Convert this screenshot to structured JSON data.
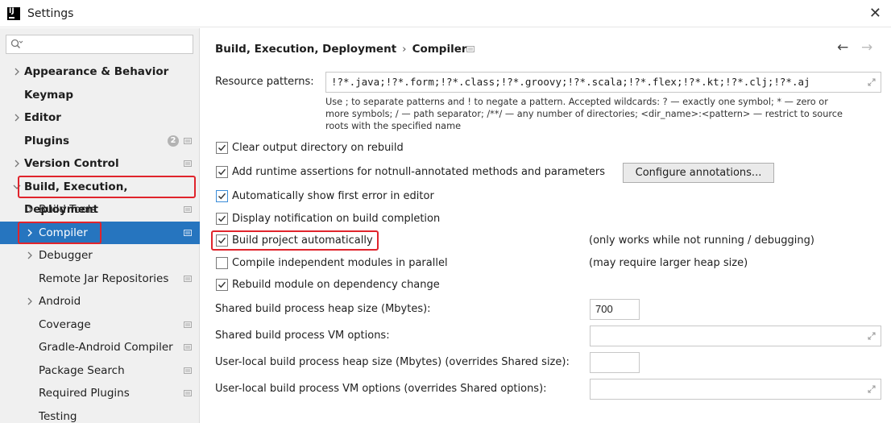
{
  "window": {
    "title": "Settings",
    "logo_text": "IJ",
    "close_symbol": "✕"
  },
  "sidebar": {
    "search_placeholder": "",
    "items": [
      {
        "label": "Appearance & Behavior",
        "expandable": true,
        "bold": true
      },
      {
        "label": "Keymap",
        "expandable": false,
        "bold": true
      },
      {
        "label": "Editor",
        "expandable": true,
        "bold": true
      },
      {
        "label": "Plugins",
        "expandable": false,
        "bold": true,
        "badge": "2"
      },
      {
        "label": "Version Control",
        "expandable": true,
        "bold": true
      },
      {
        "label": "Build, Execution, Deployment",
        "expandable": true,
        "expanded": true,
        "bold": true,
        "highlighted": true
      },
      {
        "label": "Build Tools",
        "expandable": true,
        "bold": false
      },
      {
        "label": "Compiler",
        "expandable": true,
        "bold": false,
        "selected": true,
        "highlighted": true
      },
      {
        "label": "Debugger",
        "expandable": true,
        "bold": false
      },
      {
        "label": "Remote Jar Repositories",
        "expandable": false,
        "bold": false
      },
      {
        "label": "Android",
        "expandable": true,
        "bold": false
      },
      {
        "label": "Coverage",
        "expandable": false,
        "bold": false
      },
      {
        "label": "Gradle-Android Compiler",
        "expandable": false,
        "bold": false
      },
      {
        "label": "Package Search",
        "expandable": false,
        "bold": false
      },
      {
        "label": "Required Plugins",
        "expandable": false,
        "bold": false
      },
      {
        "label": "Testing",
        "expandable": false,
        "bold": false
      }
    ]
  },
  "main": {
    "breadcrumb": {
      "parent": "Build, Execution, Deployment",
      "separator": "›",
      "current": "Compiler"
    },
    "nav": {
      "back": "←",
      "forward": "→"
    },
    "resource_patterns": {
      "label": "Resource patterns:",
      "value": "!?*.java;!?*.form;!?*.class;!?*.groovy;!?*.scala;!?*.flex;!?*.kt;!?*.clj;!?*.aj"
    },
    "hint_lines": [
      "Use ; to separate patterns and ! to negate a pattern. Accepted wildcards: ? — exactly one symbol; * — zero or",
      "more symbols; / — path separator; /**/ — any number of directories; <dir_name>:<pattern> — restrict to source",
      "roots with the specified name"
    ],
    "options": {
      "clear_output": {
        "label": "Clear output directory on rebuild",
        "checked": true
      },
      "runtime_assertions": {
        "label": "Add runtime assertions for notnull-annotated methods and parameters",
        "checked": true
      },
      "configure_annotations": "Configure annotations...",
      "show_first_error": {
        "label": "Automatically show first error in editor",
        "checked": true
      },
      "display_notification": {
        "label": "Display notification on build completion",
        "checked": true
      },
      "build_automatically": {
        "label": "Build project automatically",
        "checked": true,
        "note": "(only works while not running / debugging)"
      },
      "compile_parallel": {
        "label": "Compile independent modules in parallel",
        "checked": false,
        "note": "(may require larger heap size)"
      },
      "rebuild_on_dependency": {
        "label": "Rebuild module on dependency change",
        "checked": true
      }
    },
    "fields": {
      "shared_heap": {
        "label": "Shared build process heap size (Mbytes):",
        "value": "700"
      },
      "shared_vm": {
        "label": "Shared build process VM options:",
        "value": ""
      },
      "user_heap": {
        "label": "User-local build process heap size (Mbytes) (overrides Shared size):",
        "value": ""
      },
      "user_vm": {
        "label": "User-local build process VM options (overrides Shared options):",
        "value": ""
      }
    }
  },
  "colors": {
    "selection": "#2675bf",
    "highlight_border": "#e0242c",
    "sidebar_bg": "#f0f0f0"
  }
}
